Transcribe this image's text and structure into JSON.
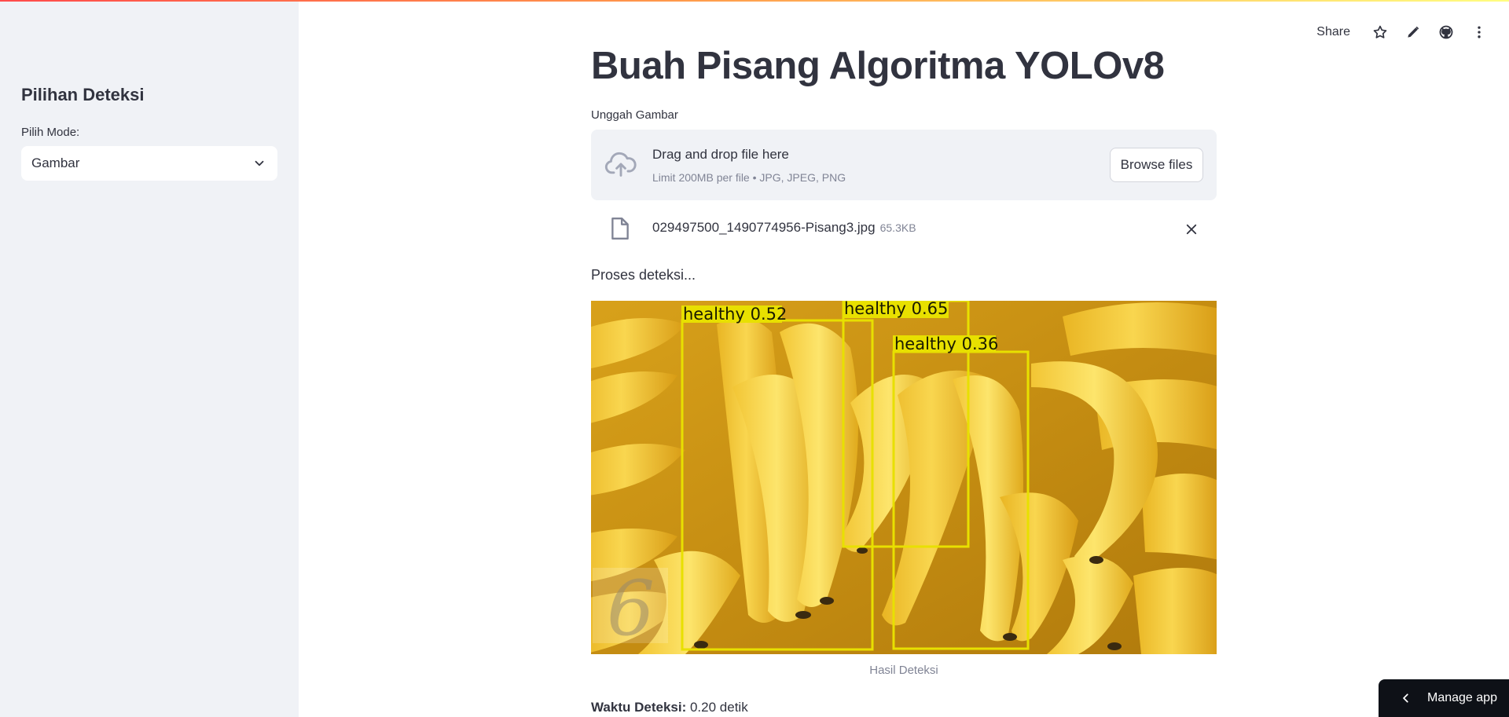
{
  "sidebar": {
    "title": "Pilihan Deteksi",
    "mode_label": "Pilih Mode:",
    "mode_value": "Gambar"
  },
  "header": {
    "share_label": "Share",
    "icons": [
      "star-icon",
      "edit-icon",
      "github-icon",
      "more-icon"
    ]
  },
  "main": {
    "title": "Buah Pisang Algoritma YOLOv8",
    "upload_label": "Unggah Gambar",
    "dropzone": {
      "text": "Drag and drop file here",
      "limit": "Limit 200MB per file • JPG, JPEG, PNG",
      "browse_label": "Browse files"
    },
    "file": {
      "name": "029497500_1490774956-Pisang3.jpg",
      "size": "65.3KB"
    },
    "status_text": "Proses deteksi...",
    "image": {
      "detections": [
        {
          "label": "healthy",
          "score": "0.52"
        },
        {
          "label": "healthy",
          "score": "0.65"
        },
        {
          "label": "healthy",
          "score": "0.36"
        }
      ],
      "box_color": "#e8e000"
    },
    "caption": "Hasil Deteksi",
    "detection_time": {
      "label": "Waktu Deteksi:",
      "value": "0.20 detik"
    }
  },
  "footer": {
    "manage_app_label": "Manage app"
  },
  "colors": {
    "sidebar_bg": "#f0f2f6",
    "text": "#31333f",
    "muted": "#808495",
    "manage_bg": "#0e1117"
  }
}
